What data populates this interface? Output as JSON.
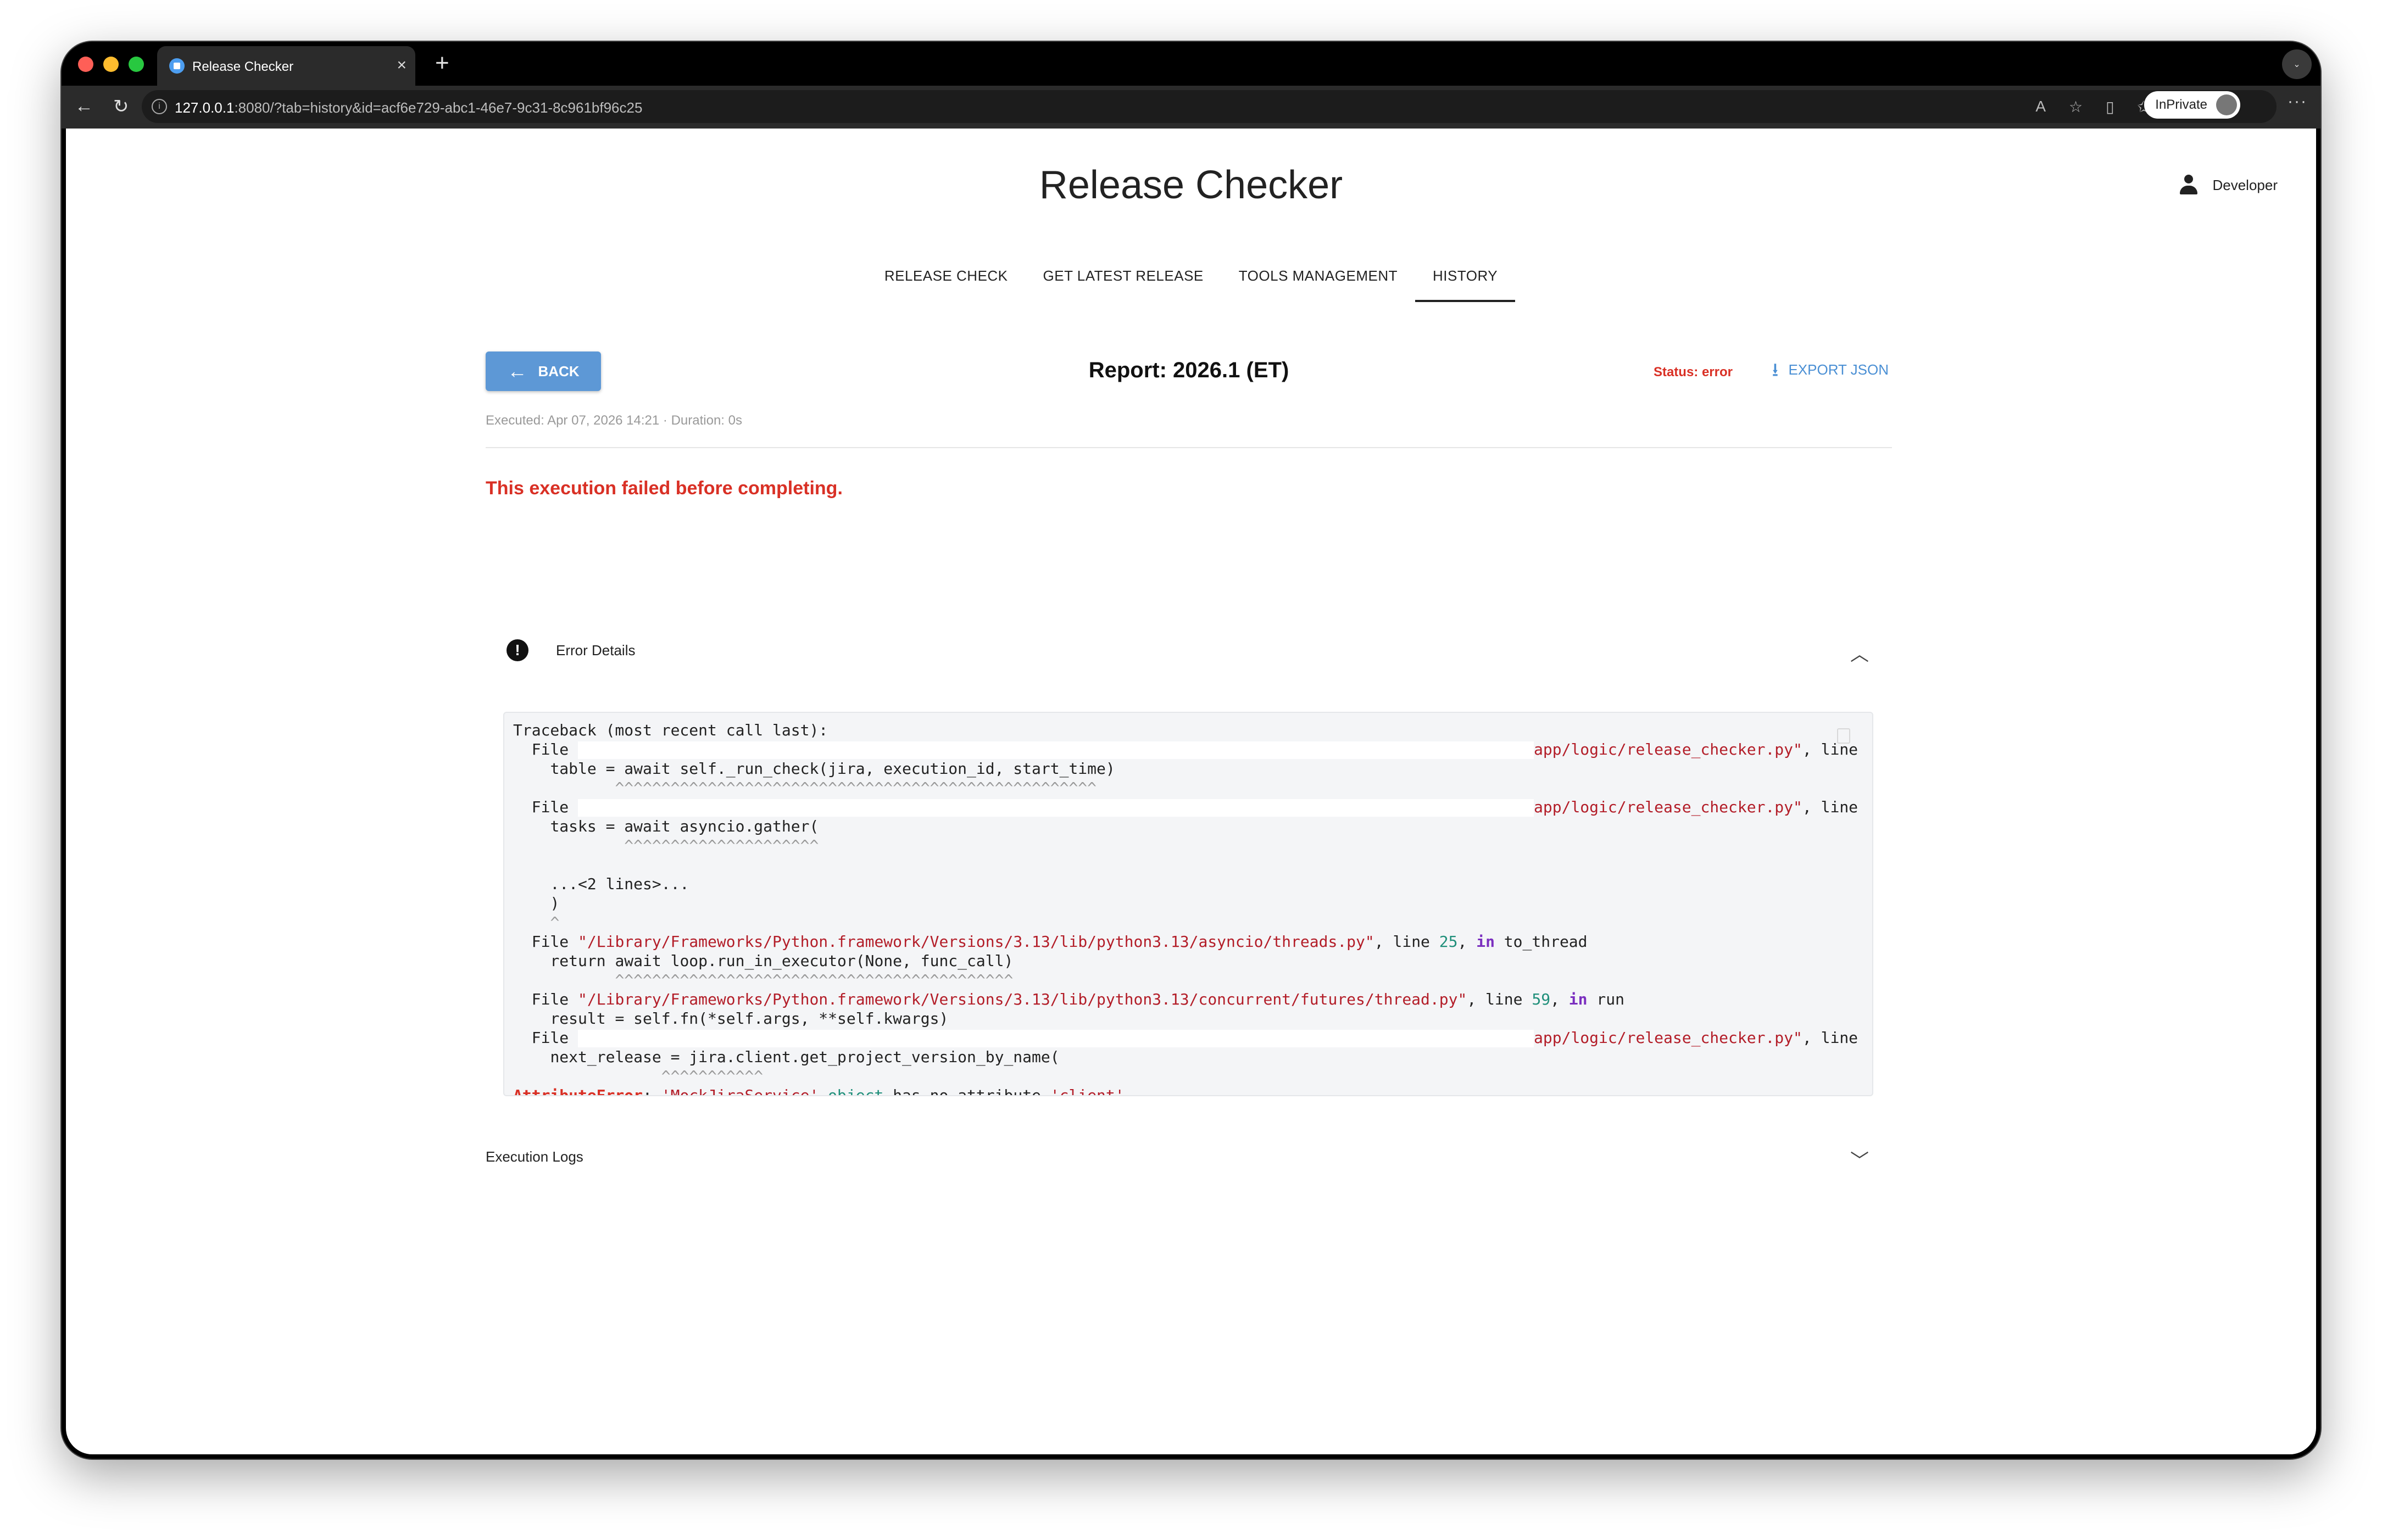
{
  "browser": {
    "tab_title": "Release Checker",
    "url_host": "127.0.0.1",
    "url_rest": ":8080/?tab=history&id=acf6e729-abc1-46e7-9c31-8c961bf96c25",
    "inprivate_label": "InPrivate"
  },
  "header": {
    "app_title": "Release Checker",
    "user_name": "Developer"
  },
  "nav": {
    "tabs": [
      {
        "label": "RELEASE CHECK",
        "active": false
      },
      {
        "label": "GET LATEST RELEASE",
        "active": false
      },
      {
        "label": "TOOLS MANAGEMENT",
        "active": false
      },
      {
        "label": "HISTORY",
        "active": true
      }
    ]
  },
  "report": {
    "back_label": "BACK",
    "title": "Report: 2026.1 (ET)",
    "status_text": "Status: error",
    "export_label": "EXPORT JSON",
    "meta": "Executed: Apr 07, 2026 14:21 · Duration: 0s",
    "failure_message": "This execution failed before completing."
  },
  "error_details": {
    "label": "Error Details",
    "expanded": true
  },
  "traceback": {
    "line_0": "Traceback (most recent call last):",
    "file_kw": "File",
    "rc_path": "app/logic/release_checker.py\"",
    "line_kw": "line",
    "in_kw": "in",
    "code_1": "table = await self._run_check(jira, execution_id, start_time)",
    "carets_1": "^^^^^^^^^^^^^^^^^^^^^^^^^^^^^^^^^^^^^^^^^^^^^^^^^^^^",
    "code_2": "tasks = await asyncio.gather(",
    "carets_2": "^^^^^^^^^^^^^^^^^^^^^",
    "elided": "...<2 lines>...",
    "close_paren": ")",
    "caret_single": "^",
    "path_threads": "\"/Library/Frameworks/Python.framework/Versions/3.13/lib/python3.13/asyncio/threads.py\"",
    "lineno_threads": "25",
    "func_threads": "to_thread",
    "code_3": "return await loop.run_in_executor(None, func_call)",
    "carets_3": "^^^^^^^^^^^^^^^^^^^^^^^^^^^^^^^^^^^^^^^^^^^",
    "path_futures": "\"/Library/Frameworks/Python.framework/Versions/3.13/lib/python3.13/concurrent/futures/thread.py\"",
    "lineno_futures": "59",
    "func_futures": "run",
    "code_4": "result = self.fn(*self.args, **self.kwargs)",
    "code_5": "next_release = jira.client.get_project_version_by_name(",
    "carets_5": "^^^^^^^^^^^",
    "error_type": "AttributeError",
    "error_message_obj": "'MockJiraService'",
    "error_message_word_object": "object",
    "error_message_mid": "has no attribute",
    "error_message_attr": "'client'"
  },
  "execution_logs": {
    "label": "Execution Logs",
    "expanded": false
  },
  "colors": {
    "accent": "#5d98d6",
    "error": "#d93025",
    "link": "#4a8fd4"
  }
}
